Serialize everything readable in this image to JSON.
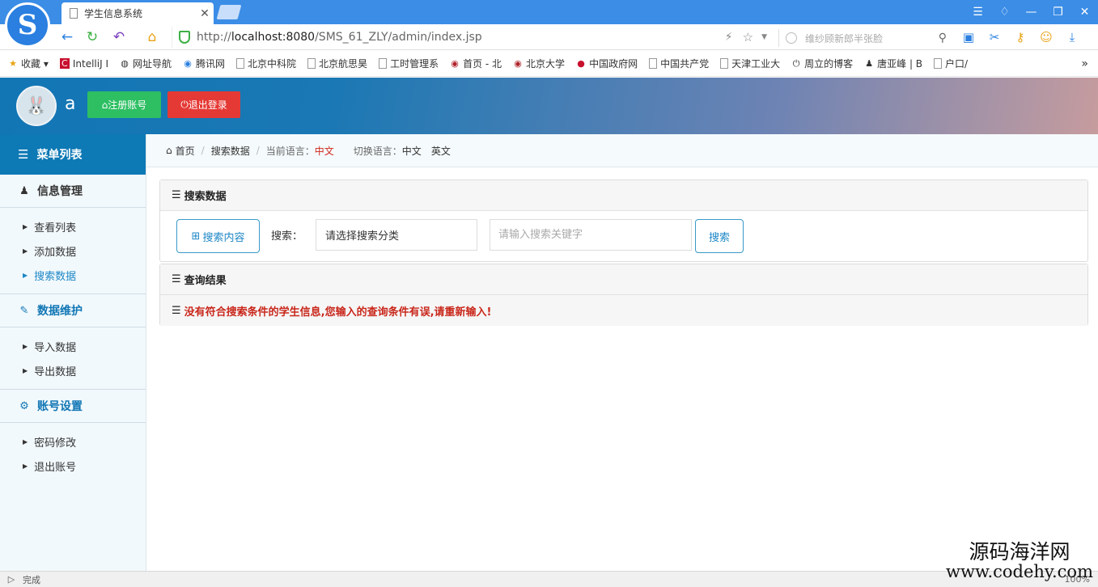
{
  "browser": {
    "tab_title": "学生信息系统",
    "url_prefix": "http://",
    "url_host": "localhost:8080",
    "url_path": "/SMS_61_ZLY/admin/index.jsp",
    "search_placeholder": "维纱顾新郎半张脸",
    "status_text": "完成",
    "zoom": "100%",
    "bookmarks": [
      "收藏",
      "IntelliJ I",
      "网址导航",
      "腾讯网",
      "北京中科院",
      "北京航思昊",
      "工时管理系",
      "首页 - 北",
      "北京大学",
      "中国政府网",
      "中国共产党",
      "天津工业大",
      "周立的博客",
      "唐亚峰 | B",
      "户口/"
    ]
  },
  "header": {
    "username": "a",
    "register_label": "注册账号",
    "logout_label": "退出登录"
  },
  "sidebar": {
    "title": "菜单列表",
    "groups": [
      {
        "label": "信息管理",
        "items": [
          "查看列表",
          "添加数据",
          "搜索数据"
        ]
      },
      {
        "label": "数据维护",
        "items": [
          "导入数据",
          "导出数据"
        ]
      },
      {
        "label": "账号设置",
        "items": [
          "密码修改",
          "退出账号"
        ]
      }
    ],
    "active_item": "搜索数据"
  },
  "breadcrumb": {
    "home": "首页",
    "current": "搜索数据",
    "lang_label": "当前语言：",
    "lang_value": "中文",
    "switch_label": "切换语言：",
    "lang_zh": "中文",
    "lang_en": "英文"
  },
  "search_panel": {
    "title": "搜索数据",
    "content_button": "搜索内容",
    "search_label": "搜索：",
    "category_select": "请选择搜索分类",
    "keyword_placeholder": "请输入搜索关键字",
    "search_button": "搜索"
  },
  "result_panel": {
    "title": "查询结果",
    "message": "没有符合搜索条件的学生信息,您输入的查询条件有误,请重新输入!"
  },
  "watermark": {
    "line1": "源码海洋网",
    "line2": "www.codehy.com"
  },
  "colors": {
    "primary": "#0d79b5",
    "success": "#2dbf62",
    "danger": "#e53935",
    "error_text": "#c9271b"
  }
}
